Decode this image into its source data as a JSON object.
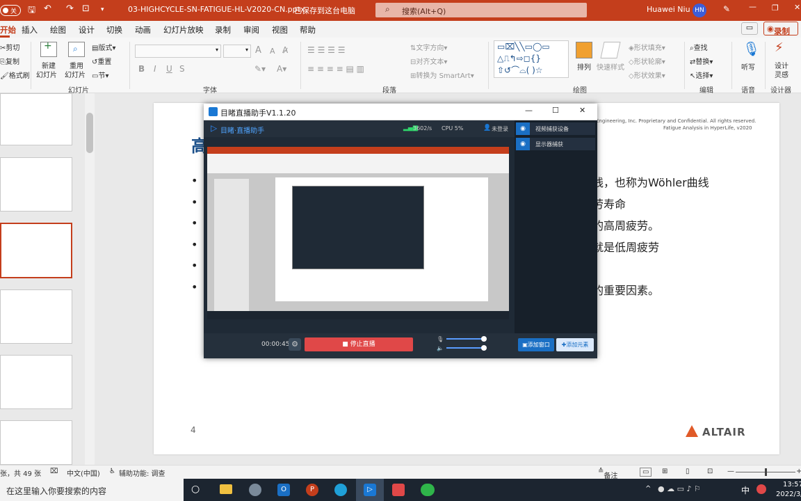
{
  "titlebar": {
    "autosave": "关",
    "filename": "03-HIGHCYCLE-SN-FATIGUE-HL-V2020-CN.pptx",
    "save_status": "已保存到这台电脑",
    "search_placeholder": "搜索(Alt+Q)",
    "user": "Huawei Niu",
    "initials": "HN"
  },
  "tabs": [
    "开始",
    "插入",
    "绘图",
    "设计",
    "切换",
    "动画",
    "幻灯片放映",
    "录制",
    "审阅",
    "视图",
    "帮助"
  ],
  "tabs_right": {
    "comment": "",
    "record": "录制"
  },
  "ribbon": {
    "clipboard": {
      "cut": "剪切",
      "copy": "复制",
      "format": "格式刷"
    },
    "slides": {
      "new": "新建",
      "new2": "幻灯片",
      "reuse": "重用",
      "reuse2": "幻灯片",
      "layout": "版式",
      "reset": "重置",
      "section": "节",
      "label": "幻灯片"
    },
    "font": {
      "label": "字体",
      "bold": "B",
      "italic": "I",
      "underline": "U",
      "strike": "S",
      "grow": "A",
      "shrink": "A"
    },
    "paragraph": {
      "label": "段落",
      "dir": "文字方向",
      "align": "对齐文本",
      "smartart": "转换为 SmartArt"
    },
    "drawing": {
      "label": "绘图",
      "arrange": "排列",
      "quick": "快速样式",
      "fill": "形状填充",
      "outline": "形状轮廓",
      "effect": "形状效果"
    },
    "editing": {
      "label": "编辑",
      "find": "查找",
      "replace": "替换",
      "select": "选择"
    },
    "voice": {
      "label": "语音",
      "dictate": "听写"
    },
    "designer": {
      "label": "设计器",
      "idea1": "设计",
      "idea2": "灵感"
    }
  },
  "slide": {
    "title_char": "高",
    "header_text1": "Engineering, Inc. Proprietary and Confidential. All rights reserved.",
    "header_text2": "Fatigue Analysis in HyperLife, v2020",
    "bullets": [
      "线，也称为Wöhler曲线",
      "劳寿命",
      "的高周疲劳。",
      "就是低周疲劳",
      "",
      "的重要因素。"
    ],
    "page_number": "4",
    "brand": "ALTAIR"
  },
  "popup": {
    "title": "目睹直播助手V1.1.20",
    "app_name": "目睹·直播助手",
    "network": "3602/s",
    "cpu": "CPU 5%",
    "login": "未登录",
    "sources": [
      "视频捕获设备",
      "显示器捕获"
    ],
    "timer": "00:00:45",
    "stop_button": "停止直播",
    "add_window": "添加窗口",
    "add_element": "添加元素"
  },
  "status": {
    "slide_count": "张，共 49 张",
    "language": "中文(中国)",
    "accessibility": "辅助功能: 调查",
    "notes": "备注"
  },
  "taskbar": {
    "search_placeholder": "在这里输入你要搜索的内容",
    "time": "13:57",
    "date": "2022/3/",
    "ime": "中"
  },
  "colors": {
    "accent": "#c43e1c",
    "brand": "#e05a28",
    "popup_bg": "#1f2a36",
    "stop": "#e04848",
    "blue": "#1a78d4"
  }
}
